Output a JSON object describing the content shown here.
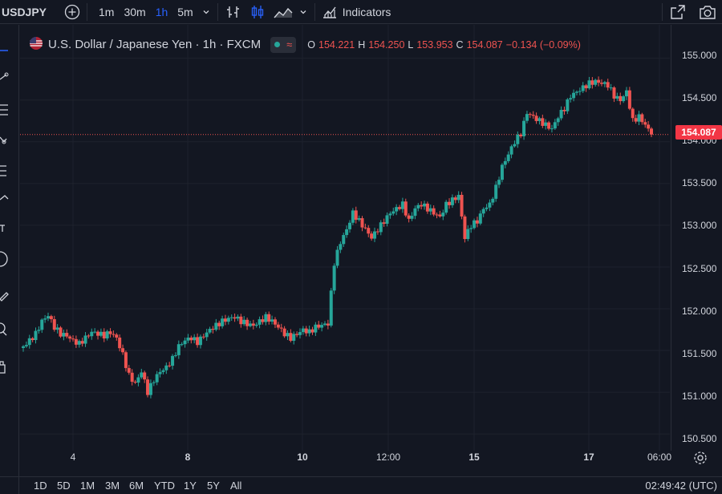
{
  "toolbar": {
    "symbol": "USDJPY",
    "timeframes": [
      "1m",
      "30m",
      "1h",
      "5m"
    ],
    "active_timeframe": "1h",
    "indicators_label": "Indicators"
  },
  "legend": {
    "title": "U.S. Dollar / Japanese Yen · 1h · FXCM",
    "o_label": "O",
    "o_value": "154.221",
    "h_label": "H",
    "h_value": "154.250",
    "l_label": "L",
    "l_value": "153.953",
    "c_label": "C",
    "c_value": "154.087",
    "change": "−0.134 (−0.09%)"
  },
  "price_axis": {
    "ticks": [
      "155.000",
      "154.500",
      "154.000",
      "153.500",
      "153.000",
      "152.500",
      "152.000",
      "151.500",
      "151.000",
      "150.500"
    ],
    "last_price": "154.087"
  },
  "time_axis": {
    "ticks": [
      "4",
      "8",
      "10",
      "12:00",
      "15",
      "17",
      "06:00"
    ]
  },
  "ranges": [
    "1D",
    "5D",
    "1M",
    "3M",
    "6M",
    "YTD",
    "1Y",
    "5Y",
    "All"
  ],
  "clock": "02:49:42 (UTC)",
  "colors": {
    "up": "#26a69a",
    "down": "#ef5350",
    "background": "#131722",
    "accent": "#2962ff"
  },
  "chart_data": {
    "type": "candlestick",
    "title": "U.S. Dollar / Japanese Yen · 1h · FXCM",
    "ylim": [
      150.3,
      155.4
    ],
    "x_labels": [
      "4",
      "8",
      "10",
      "12:00",
      "15",
      "17",
      "06:00"
    ],
    "series": [
      {
        "name": "USDJPY",
        "anchors_close": [
          151.55,
          151.62,
          151.7,
          151.85,
          151.92,
          151.78,
          151.7,
          151.68,
          151.62,
          151.58,
          151.65,
          151.72,
          151.7,
          151.68,
          151.72,
          151.65,
          151.45,
          151.2,
          151.1,
          151.25,
          151.0,
          151.15,
          151.25,
          151.3,
          151.4,
          151.55,
          151.62,
          151.65,
          151.6,
          151.68,
          151.75,
          151.8,
          151.85,
          151.88,
          151.9,
          151.85,
          151.82,
          151.8,
          151.85,
          151.9,
          151.85,
          151.78,
          151.7,
          151.65,
          151.7,
          151.75,
          151.72,
          151.78,
          151.8,
          151.82,
          152.55,
          152.8,
          152.95,
          153.15,
          153.05,
          152.95,
          152.85,
          152.95,
          153.05,
          153.15,
          153.2,
          153.25,
          153.05,
          153.2,
          153.25,
          153.2,
          153.15,
          153.1,
          153.25,
          153.3,
          153.35,
          152.85,
          153.0,
          153.05,
          153.2,
          153.25,
          153.45,
          153.7,
          153.85,
          154.0,
          154.1,
          154.35,
          154.3,
          154.25,
          154.2,
          154.15,
          154.3,
          154.4,
          154.55,
          154.6,
          154.65,
          154.7,
          154.72,
          154.7,
          154.68,
          154.55,
          154.5,
          154.6,
          154.25,
          154.3,
          154.2,
          154.087
        ]
      }
    ]
  }
}
